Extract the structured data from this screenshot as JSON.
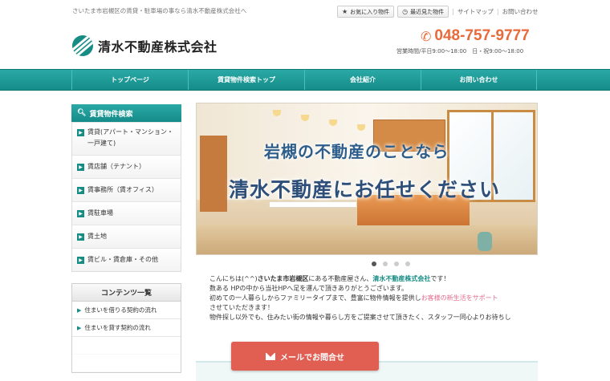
{
  "topbar": {
    "tagline": "さいたま市岩槻区の賃貸・駐車場の事なら清水不動産株式会社へ",
    "favorites": "お気に入り物件",
    "recent": "最近見た物件",
    "sitemap": "サイトマップ",
    "contact": "お問い合わせ"
  },
  "header": {
    "company": "清水不動産株式会社",
    "phone": "048-757-9777",
    "hours": "営業時間/平日9:00～18:00　日・祝9:00～18:00"
  },
  "nav": {
    "items": [
      "トップページ",
      "賃貸物件検索トップ",
      "会社紹介",
      "お問い合わせ"
    ]
  },
  "sidebar": {
    "search_title": "賃貸物件検索",
    "items": [
      "賃貸(アパート・マンション・一戸建て)",
      "賃店舗（テナント）",
      "賃事務所（賃オフィス）",
      "賃駐車場",
      "賃土地",
      "賃ビル・賃倉庫・その他"
    ],
    "contents_title": "コンテンツ一覧",
    "contents_items": [
      "住まいを借りる契約の流れ",
      "住まいを貸す契約の流れ"
    ]
  },
  "hero": {
    "line1": "岩槻の不動産のことなら",
    "line2": "清水不動産にお任せください"
  },
  "intro": {
    "p1_a": "こんにちは(^^)",
    "p1_b": "さいたま市岩槻区",
    "p1_c": "にある不動産屋さん、",
    "p1_d": "清水不動産株式会社",
    "p1_e": "です！",
    "p2": "数ある HPの中から当社HPへ足を運んで頂きありがとうございます。",
    "p3": "初めての一人暮らしからファミリータイプまで、豊富に物件情報を提供し",
    "p3_pink": "お客様の新生活をサポート",
    "p4": "させていただきます！",
    "p5": "物件探し以外でも、住みたい街の情報や暮らし方をご提案させて頂きたく、スタッフ一同心よりお待ちし"
  },
  "mail_button": {
    "label": "メールでお問合せ"
  },
  "colors": {
    "teal": "#178c85",
    "orange": "#e8693a",
    "mail_button": "#e05e52",
    "pink": "#e36d8e"
  }
}
